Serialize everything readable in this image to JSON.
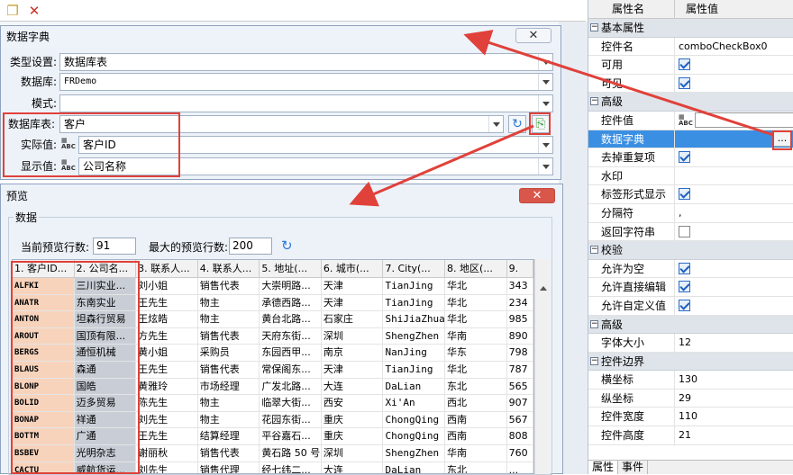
{
  "toolbar": {
    "items": [
      "paste-icon",
      "delete-icon"
    ]
  },
  "dialog_dict": {
    "title": "数据字典",
    "close": "✕",
    "type_label": "类型设置:",
    "type_value": "数据库表",
    "db_label": "数据库:",
    "db_value": "FRDemo",
    "schema_label": "模式:",
    "schema_value": "",
    "table_label": "数据库表:",
    "table_value": "客户",
    "actual_label": "实际值:",
    "actual_value": "客户ID",
    "display_label": "显示值:",
    "display_value": "公司名称"
  },
  "dialog_preview": {
    "title": "预览",
    "close": "✕",
    "group_label": "数据",
    "current_rows_label": "当前预览行数:",
    "current_rows_value": "91",
    "max_rows_label": "最大的预览行数:",
    "max_rows_value": "200",
    "columns": [
      "1. 客户ID...",
      "2. 公司名...",
      "3. 联系人...",
      "4. 联系人...",
      "5. 地址(...",
      "6. 城市(...",
      "7. City(...",
      "8. 地区(...",
      "9."
    ],
    "rows": [
      [
        "ALFKI",
        "三川实业...",
        "刘小姐",
        "销售代表",
        "大崇明路...",
        "天津",
        "TianJing",
        "华北",
        "343"
      ],
      [
        "ANATR",
        "东南实业",
        "王先生",
        "物主",
        "承德西路...",
        "天津",
        "TianJing",
        "华北",
        "234"
      ],
      [
        "ANTON",
        "坦森行贸易",
        "王炫皓",
        "物主",
        "黄台北路...",
        "石家庄",
        "ShiJiaZhuang",
        "华北",
        "985"
      ],
      [
        "AROUT",
        "国顶有限...",
        "方先生",
        "销售代表",
        "天府东街...",
        "深圳",
        "ShengZhen",
        "华南",
        "890"
      ],
      [
        "BERGS",
        "通恒机械",
        "黄小姐",
        "采购员",
        "东园西甲...",
        "南京",
        "NanJing",
        "华东",
        "798"
      ],
      [
        "BLAUS",
        "森通",
        "王先生",
        "销售代表",
        "常保阁东...",
        "天津",
        "TianJing",
        "华北",
        "787"
      ],
      [
        "BLONP",
        "国皓",
        "黄雅玲",
        "市场经理",
        "广发北路...",
        "大连",
        "DaLian",
        "东北",
        "565"
      ],
      [
        "BOLID",
        "迈多贸易",
        "陈先生",
        "物主",
        "临翠大街...",
        "西安",
        "Xi'An",
        "西北",
        "907"
      ],
      [
        "BONAP",
        "祥通",
        "刘先生",
        "物主",
        "花园东街...",
        "重庆",
        "ChongQing",
        "西南",
        "567"
      ],
      [
        "BOTTM",
        "广通",
        "王先生",
        "结算经理",
        "平谷嘉石...",
        "重庆",
        "ChongQing",
        "西南",
        "808"
      ],
      [
        "BSBEV",
        "光明杂志",
        "谢丽秋",
        "销售代表",
        "黄石路 50 号",
        "深圳",
        "ShengZhen",
        "华南",
        "760"
      ],
      [
        "CACTU",
        "威航货运...",
        "刘先生",
        "销售代理",
        "经七纬二...",
        "大连",
        "DaLian",
        "东北",
        "..."
      ]
    ]
  },
  "properties": {
    "header_name": "属性名",
    "header_value": "属性值",
    "sections": [
      {
        "title": "基本属性",
        "rows": [
          {
            "k": "控件名",
            "v": "comboCheckBox0",
            "t": "text"
          },
          {
            "k": "可用",
            "v": "on",
            "t": "check"
          },
          {
            "k": "可见",
            "v": "on",
            "t": "check"
          }
        ]
      },
      {
        "title": "高级",
        "rows": [
          {
            "k": "控件值",
            "v": "",
            "t": "abc"
          },
          {
            "k": "数据字典",
            "v": "...",
            "t": "dict"
          },
          {
            "k": "去掉重复项",
            "v": "on",
            "t": "check"
          },
          {
            "k": "水印",
            "v": "",
            "t": "text"
          },
          {
            "k": "标签形式显示",
            "v": "on",
            "t": "check"
          },
          {
            "k": "分隔符",
            "v": ",",
            "t": "text"
          },
          {
            "k": "返回字符串",
            "v": "off",
            "t": "check"
          }
        ]
      },
      {
        "title": "校验",
        "rows": [
          {
            "k": "允许为空",
            "v": "on",
            "t": "check"
          },
          {
            "k": "允许直接编辑",
            "v": "on",
            "t": "check"
          },
          {
            "k": "允许自定义值",
            "v": "on",
            "t": "check"
          }
        ]
      },
      {
        "title": "高级",
        "rows": [
          {
            "k": "字体大小",
            "v": "12",
            "t": "text"
          }
        ]
      },
      {
        "title": "控件边界",
        "rows": [
          {
            "k": "横坐标",
            "v": "130",
            "t": "text"
          },
          {
            "k": "纵坐标",
            "v": "29",
            "t": "text"
          },
          {
            "k": "控件宽度",
            "v": "110",
            "t": "text"
          },
          {
            "k": "控件高度",
            "v": "21",
            "t": "text"
          }
        ]
      }
    ],
    "tabs": [
      "属性",
      "事件"
    ]
  },
  "colors": {
    "accent": "#3b8fe2",
    "annotation": "#e0413a"
  }
}
